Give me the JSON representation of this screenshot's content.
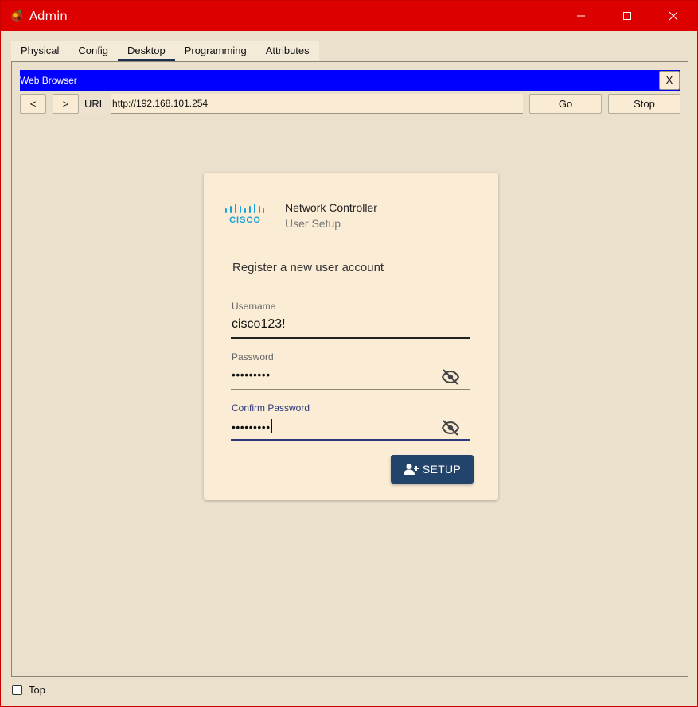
{
  "window": {
    "title": "Admin",
    "colors": {
      "titlebar": "#dd0000",
      "background": "#eae0cc"
    }
  },
  "tabs": [
    {
      "label": "Physical"
    },
    {
      "label": "Config"
    },
    {
      "label": "Desktop",
      "active": true
    },
    {
      "label": "Programming"
    },
    {
      "label": "Attributes"
    }
  ],
  "browser": {
    "title": "Web Browser",
    "close_label": "X",
    "back_label": "<",
    "forward_label": ">",
    "url_label": "URL",
    "url_value": "http://192.168.101.254",
    "go_label": "Go",
    "stop_label": "Stop",
    "colors": {
      "title_bar": "#0000ff"
    }
  },
  "setup_card": {
    "logo_text": "CISCO",
    "product": "Network Controller",
    "subtitle": "User Setup",
    "heading": "Register a new user account",
    "username": {
      "label": "Username",
      "value": "cisco123!"
    },
    "password": {
      "label": "Password",
      "value": "•••••••••",
      "icon": "eye-off-icon"
    },
    "confirm_password": {
      "label": "Confirm Password",
      "value": "•••••••••",
      "icon": "eye-off-icon",
      "focused": true
    },
    "setup_button": {
      "label": "SETUP",
      "icon": "add-user-icon"
    },
    "colors": {
      "button": "#22446a",
      "focus": "#2c3a7a",
      "logo": "#1ba0d7"
    }
  },
  "footer": {
    "top_label": "Top",
    "top_checked": false
  }
}
